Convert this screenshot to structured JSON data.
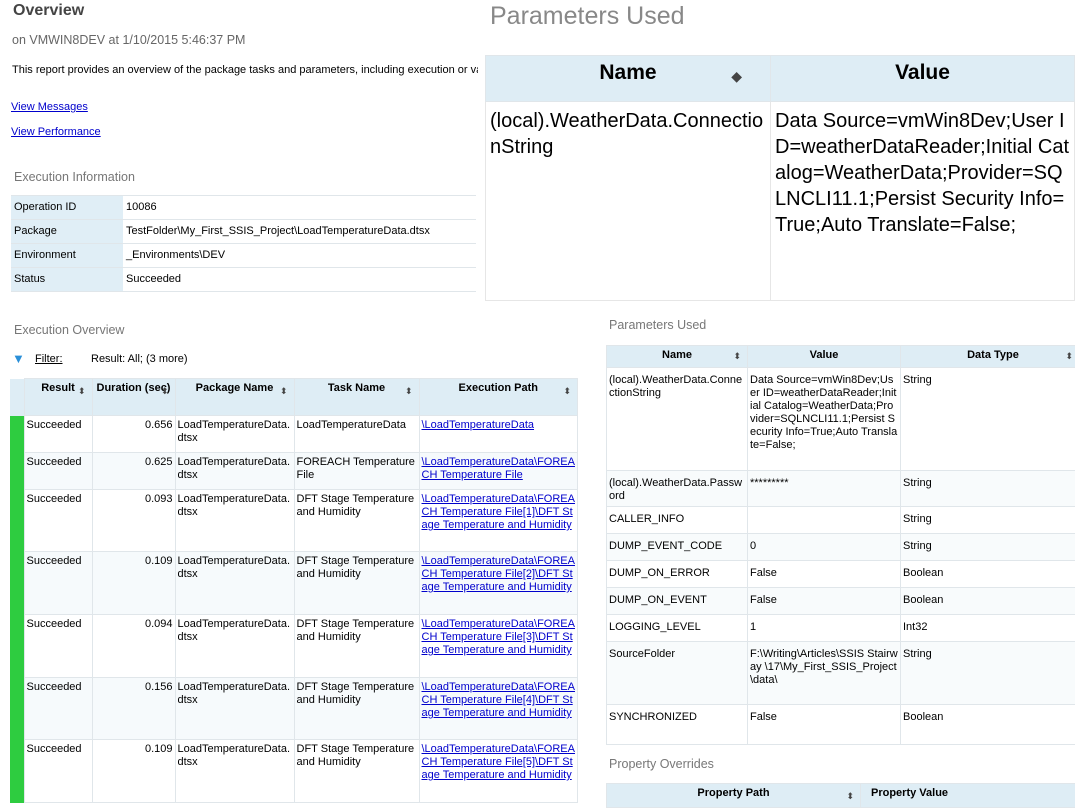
{
  "overview": {
    "title": "Overview",
    "subtitle": "on VMWIN8DEV at 1/10/2015 5:46:37 PM",
    "description": "This report provides an overview of the package tasks and parameters, including execution or validation information.",
    "links": [
      "View Messages",
      "View Performance"
    ]
  },
  "execution_information": {
    "title": "Execution Information",
    "rows": [
      [
        "Operation ID",
        "10086"
      ],
      [
        "Package",
        "TestFolder\\My_First_SSIS_Project\\LoadTemperatureData.dtsx"
      ],
      [
        "Environment",
        "_Environments\\DEV"
      ],
      [
        "Status",
        "Succeeded"
      ]
    ]
  },
  "execution_overview": {
    "title": "Execution Overview",
    "filter_label": "Filter:",
    "filter_value": "Result: All;  (3 more)",
    "status_color": "#2ecc40",
    "columns": [
      "Result",
      "Duration (sec)",
      "Package Name",
      "Task Name",
      "Execution Path"
    ],
    "rows": [
      [
        "Succeeded",
        "0.656",
        "LoadTemperatureData.dtsx",
        "LoadTemperatureData",
        "\\LoadTemperatureData"
      ],
      [
        "Succeeded",
        "0.625",
        "LoadTemperatureData.dtsx",
        "FOREACH Temperature File",
        "\\LoadTemperatureData\\FOREACH Temperature File"
      ],
      [
        "Succeeded",
        "0.093",
        "LoadTemperatureData.dtsx",
        "DFT Stage Temperature and Humidity",
        "\\LoadTemperatureData\\FOREACH Temperature File[1]\\DFT Stage Temperature and Humidity"
      ],
      [
        "Succeeded",
        "0.109",
        "LoadTemperatureData.dtsx",
        "DFT Stage Temperature and Humidity",
        "\\LoadTemperatureData\\FOREACH Temperature File[2]\\DFT Stage Temperature and Humidity"
      ],
      [
        "Succeeded",
        "0.094",
        "LoadTemperatureData.dtsx",
        "DFT Stage Temperature and Humidity",
        "\\LoadTemperatureData\\FOREACH Temperature File[3]\\DFT Stage Temperature and Humidity"
      ],
      [
        "Succeeded",
        "0.156",
        "LoadTemperatureData.dtsx",
        "DFT Stage Temperature and Humidity",
        "\\LoadTemperatureData\\FOREACH Temperature File[4]\\DFT Stage Temperature and Humidity"
      ],
      [
        "Succeeded",
        "0.109",
        "LoadTemperatureData.dtsx",
        "DFT Stage Temperature and Humidity",
        "\\LoadTemperatureData\\FOREACH Temperature File[5]\\DFT Stage Temperature and Humidity"
      ]
    ]
  },
  "parameters_used": {
    "title": "Parameters Used",
    "columns": [
      "Name",
      "Value",
      "Data Type"
    ],
    "rows": [
      [
        "(local).WeatherData.ConnectionString",
        "Data Source=vmWin8Dev;User ID=weatherDataReader;Initial Catalog=WeatherData;Provider=SQLNCLI11.1;Persist Security Info=True;Auto Translate=False;",
        "String"
      ],
      [
        "(local).WeatherData.Password",
        "*********",
        "String"
      ],
      [
        "CALLER_INFO",
        "",
        "String"
      ],
      [
        "DUMP_EVENT_CODE",
        "0",
        "String"
      ],
      [
        "DUMP_ON_ERROR",
        "False",
        "Boolean"
      ],
      [
        "DUMP_ON_EVENT",
        "False",
        "Boolean"
      ],
      [
        "LOGGING_LEVEL",
        "1",
        "Int32"
      ],
      [
        "SourceFolder",
        "F:\\Writing\\Articles\\SSIS Stairway \\17\\My_First_SSIS_Project \\data\\",
        "String"
      ],
      [
        "SYNCHRONIZED",
        "False",
        "Boolean"
      ]
    ]
  },
  "property_overrides": {
    "title": "Property Overrides",
    "columns": [
      "Property Path",
      "Property Value"
    ]
  }
}
